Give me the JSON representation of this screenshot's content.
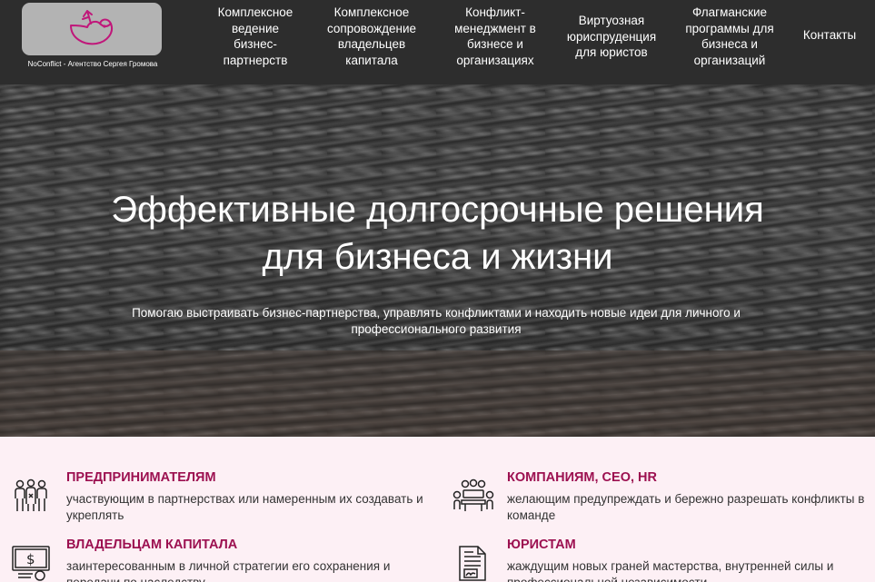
{
  "logo": {
    "caption": "NoConflict - Агентство Сергея Громова",
    "icon": "dove-icon"
  },
  "nav": [
    {
      "label": "Комплексное\nведение\nбизнес-\nпартнерств"
    },
    {
      "label": "Комплексное\nсопровождение\nвладельцев\nкапитала"
    },
    {
      "label": "Конфликт-\nменеджмент в\nбизнесе и\nорганизациях"
    },
    {
      "label": "Виртуозная\nюриспруденция\nдля юристов"
    },
    {
      "label": "Флагманские\nпрограммы для\nбизнеса и\nорганизаций"
    },
    {
      "label": "Контакты"
    }
  ],
  "hero": {
    "title": "Эффективные долгосрочные решения\nдля бизнеса и жизни",
    "subtitle": "Помогаю выстраивать бизнес-партнерства, управлять конфликтами и находить новые идеи для личного и профессионального развития"
  },
  "audiences": [
    {
      "title": "ПРЕДПРИНИМАТЕЛЯМ",
      "desc": "участвующим в партнерствах или намеренным их создавать и укреплять",
      "icon": "partners-group-icon"
    },
    {
      "title": "КОМПАНИЯМ, CEO, HR",
      "desc": "желающим предупреждать и бережно разрешать конфликты в команде",
      "icon": "team-meeting-icon"
    },
    {
      "title": "ВЛАДЕЛЬЦАМ КАПИТАЛА",
      "desc": "заинтересованным в личной стратегии его сохранения и передачи по наследству",
      "icon": "certificate-dollar-icon"
    },
    {
      "title": "ЮРИСТАМ",
      "desc": "жаждущим новых граней мастерства, внутренней силы и профессиональной независимости",
      "icon": "signed-document-icon"
    }
  ],
  "colors": {
    "header_bg": "#2d2d2d",
    "accent": "#9c1050",
    "logo_bird": "#c0177a",
    "section_bg": "#fdf0f5"
  }
}
